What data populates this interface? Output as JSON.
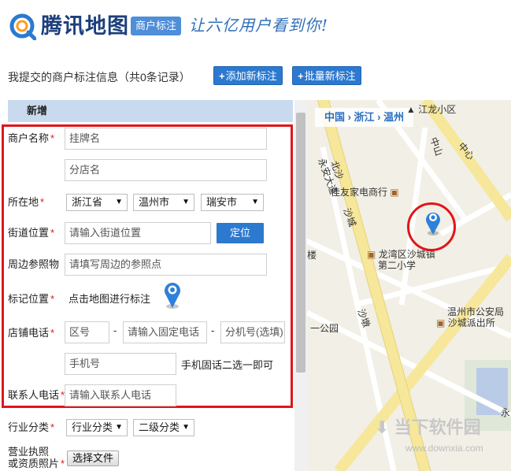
{
  "header": {
    "brand": "腾讯地图",
    "tag": "商户标注",
    "slogan": "让六亿用户看到你!"
  },
  "toolbar": {
    "subtitle": "我提交的商户标注信息（共0条记录）",
    "add_label": "添加新标注",
    "batch_label": "批量新标注"
  },
  "form": {
    "section_title": "新增",
    "merchant_label": "商户名称",
    "name_placeholder": "挂牌名",
    "branch_placeholder": "分店名",
    "location_label": "所在地",
    "province": "浙江省",
    "city": "温州市",
    "district": "瑞安市",
    "street_label": "街道位置",
    "street_placeholder": "请输入街道位置",
    "locate_label": "定位",
    "landmark_label": "周边参照物",
    "landmark_placeholder": "请填写周边的参照点",
    "mark_label": "标记位置",
    "mark_text": "点击地图进行标注",
    "phone_label": "店铺电话",
    "area_code_placeholder": "区号",
    "fixed_phone_placeholder": "请输入固定电话",
    "extension_placeholder": "分机号(选填)",
    "mobile_placeholder": "手机号",
    "phone_hint": "手机固话二选一即可",
    "contact_label": "联系人电话",
    "contact_placeholder": "请输入联系人电话",
    "industry_label": "行业分类",
    "industry_primary": "行业分类",
    "industry_secondary": "二级分类",
    "license_label_line1": "营业执照",
    "license_label_line2": "或资质照片",
    "file_button": "选择文件",
    "required_mark": "*",
    "dash": "-"
  },
  "map": {
    "crumbs": "中国 › 浙江 › 温州",
    "labels": {
      "jianglong": "江龙小区",
      "zhongshan1": "中山",
      "zhongshan2": "中心",
      "yongan": "永安大道",
      "beisha": "北沙",
      "jiayi": "佳友家电商行",
      "shacheng": "沙城",
      "longwan": "龙湾区沙城镇",
      "school": "第二小学",
      "lou": "楼",
      "park": "一公园",
      "police1": "温州市公安局",
      "police2": "沙城派出所",
      "shadun": "沙墩",
      "yong": "永"
    }
  },
  "watermark": {
    "name": "当下软件园",
    "url": "www.downxia.com"
  },
  "colors": {
    "accent": "#2c79cf",
    "highlight": "#e1151b",
    "panel_header": "#c9daee",
    "brand": "#1d3f7c"
  }
}
